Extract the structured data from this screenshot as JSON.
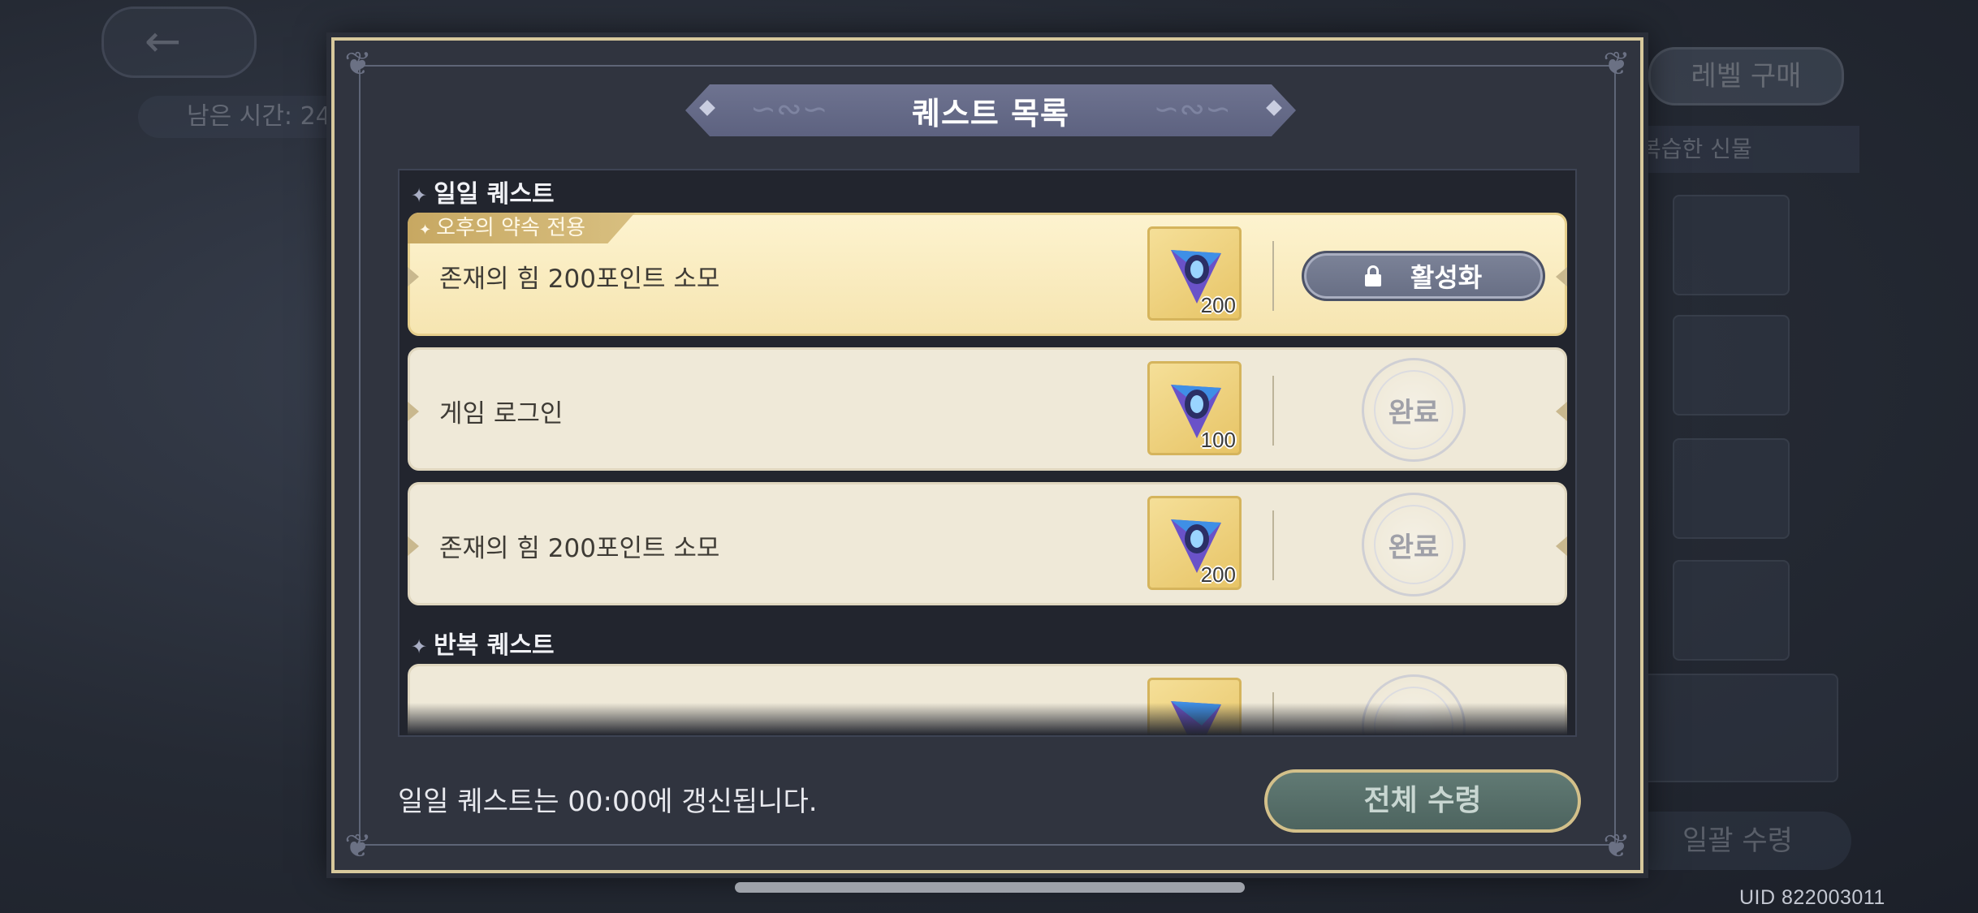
{
  "background": {
    "timer_text": "남은 시간: 24",
    "level_buy_label": "레벨 구매",
    "side_banner_text": "복습한 신물",
    "bottom_button_label": "일괄 수령"
  },
  "uid_text": "UID 822003011",
  "dialog": {
    "title": "퀘스트 목록",
    "sections": {
      "daily": "일일 퀘스트",
      "repeat": "반복 퀘스트"
    },
    "quests": [
      {
        "tag": "오후의 약속 전용",
        "name": "존재의 힘 200포인트 소모",
        "reward_count": "200",
        "action_label": "활성화",
        "state": "locked"
      },
      {
        "name": "게임 로그인",
        "reward_count": "100",
        "action_label": "완료",
        "state": "completed"
      },
      {
        "name": "존재의 힘 200포인트 소모",
        "reward_count": "200",
        "action_label": "완료",
        "state": "completed"
      }
    ],
    "footer_note": "일일 퀘스트는 00:00에 갱신됩니다.",
    "claim_all_label": "전체 수령"
  },
  "icons": {
    "reward": "crystal-gem-icon",
    "lock": "lock-icon",
    "section": "sparkle-icon",
    "back": "back-arrow-icon"
  },
  "colors": {
    "dialog_border": "#d8c99c",
    "featured_row": "#f6e5b1",
    "normal_row": "#efe9d8",
    "claim_button": "#567069"
  }
}
